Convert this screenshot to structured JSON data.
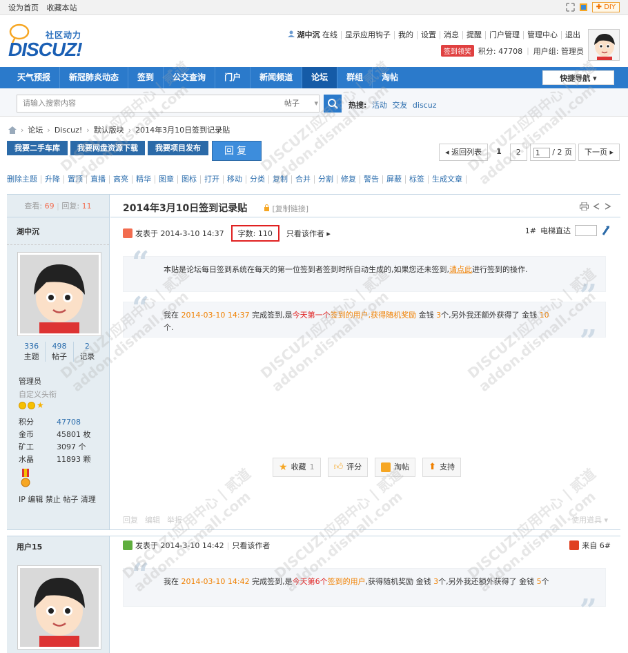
{
  "topbar": {
    "set_home": "设为首页",
    "favorite": "收藏本站",
    "diy": "DIY"
  },
  "header": {
    "logo_cn": "社区动力",
    "logo_en": "DISCUZ!",
    "username": "湖中沉",
    "online": "在线",
    "links": [
      "显示应用钩子",
      "我的",
      "设置",
      "消息",
      "提醒",
      "门户管理",
      "管理中心",
      "退出"
    ],
    "sign_badge": "签到领奖",
    "points": "积分: 47708",
    "user_group": "用户组: 管理员"
  },
  "nav": {
    "items": [
      "天气预报",
      "新冠肺炎动态",
      "签到",
      "公交查询",
      "门户",
      "新闻频道",
      "论坛",
      "群组",
      "淘帖"
    ],
    "active_index": 6,
    "quick_nav": "快捷导航"
  },
  "search": {
    "placeholder": "请输入搜索内容",
    "type": "帖子",
    "hot_label": "热搜:",
    "hot_items": [
      "活动",
      "交友",
      "discuz"
    ]
  },
  "breadcrumb": [
    "论坛",
    "Discuz!",
    "默认版块",
    "2014年3月10日签到记录贴"
  ],
  "action_buttons": [
    "我要二手车库",
    "我要网盘资源下载",
    "我要项目发布"
  ],
  "reply_label": "回复",
  "pager": {
    "back": "返回列表",
    "page1": "1",
    "page2": "2",
    "current": "1",
    "total": "/ 2 页",
    "next": "下一页"
  },
  "admin_ops": [
    "删除主题",
    "升降",
    "置顶",
    "直播",
    "高亮",
    "精华",
    "图章",
    "图标",
    "打开",
    "移动",
    "分类",
    "复制",
    "合并",
    "分割",
    "修复",
    "警告",
    "屏蔽",
    "标签",
    "生成文章"
  ],
  "thread": {
    "views_label": "查看:",
    "views": "69",
    "replies_label": "回复:",
    "replies": "11",
    "title": "2014年3月10日签到记录贴",
    "copy_link": "[复制链接]"
  },
  "post1": {
    "author": "湖中沉",
    "topics": "336",
    "topics_label": "主题",
    "posts": "498",
    "posts_label": "帖子",
    "records": "2",
    "records_label": "记录",
    "group": "管理员",
    "custom_title": "自定义头衔",
    "profile": [
      {
        "k": "积分",
        "v": "47708"
      },
      {
        "k": "金币",
        "v": "45801 枚"
      },
      {
        "k": "矿工",
        "v": "3097 个"
      },
      {
        "k": "水晶",
        "v": "11893 颗"
      }
    ],
    "ip_ops": "IP 编辑 禁止 帖子 清理",
    "posted_at": "发表于 2014-3-10 14:37",
    "word_count": "字数: 110",
    "author_only": "只看该作者",
    "floor": "1#",
    "elevator": "电梯直达",
    "quote1_a": "本贴是论坛每日签到系统在每天的第一位签到者签到时所自动生成的,如果您还未签到,",
    "quote1_link": "请点此",
    "quote1_b": "进行签到的操作.",
    "q2_pre": "我在 ",
    "q2_time": "2014-03-10 14:37",
    "q2_mid": " 完成签到,是",
    "q2_today": "今天第一个",
    "q2_rank": "签到的用户,获得随机奖励",
    "q2_rest": " 金钱 ",
    "q2_money": "3",
    "q2_rest2": "个,另外我还额外获得了 金钱 ",
    "q2_extra": "10",
    "q2_end": "个.",
    "btns": [
      "收藏",
      "评分",
      "淘帖",
      "支持"
    ],
    "fav_count": "1",
    "foot": [
      "回复",
      "编辑",
      "举报"
    ],
    "use_tool": "使用道具"
  },
  "post2": {
    "author": "用户15",
    "posted_at": "发表于 2014-3-10 14:42",
    "author_only": "只看该作者",
    "from": "来自 6#",
    "q_pre": "我在 ",
    "q_time": "2014-03-10 14:42",
    "q_mid": " 完成签到,是",
    "q_today": "今天第6个",
    "q_rank": "签到的用户",
    "q_rest": ",获得随机奖励 金钱 ",
    "q_money": "3",
    "q_rest2": "个,另外我还额外获得了 金钱 ",
    "q_extra": "5",
    "q_end": "个"
  },
  "watermark": [
    "DISCUZ!应用中心 | 贰道",
    "addon.dismall.com"
  ],
  "colors": {
    "nav_blue": "#2b7acb",
    "link_blue": "#2b6dad",
    "orange": "#f08000",
    "red": "#e02020"
  }
}
